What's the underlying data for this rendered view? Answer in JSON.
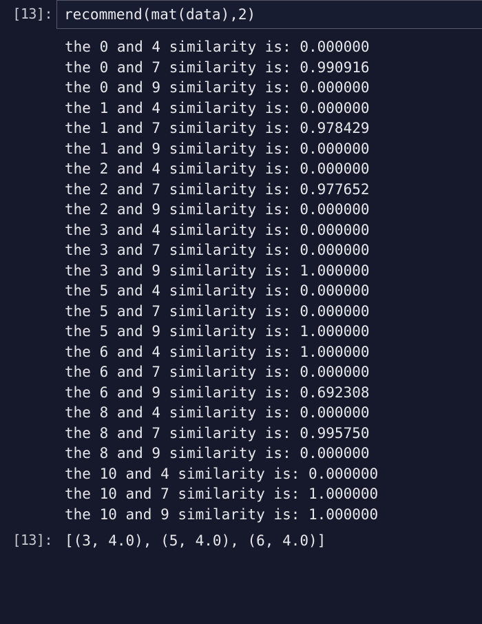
{
  "input_prompt": "[13]:",
  "input_code": "recommend(mat(data),2)",
  "output_prompt": "[13]:",
  "output_lines": [
    "the 0 and 4 similarity is: 0.000000",
    "the 0 and 7 similarity is: 0.990916",
    "the 0 and 9 similarity is: 0.000000",
    "the 1 and 4 similarity is: 0.000000",
    "the 1 and 7 similarity is: 0.978429",
    "the 1 and 9 similarity is: 0.000000",
    "the 2 and 4 similarity is: 0.000000",
    "the 2 and 7 similarity is: 0.977652",
    "the 2 and 9 similarity is: 0.000000",
    "the 3 and 4 similarity is: 0.000000",
    "the 3 and 7 similarity is: 0.000000",
    "the 3 and 9 similarity is: 1.000000",
    "the 5 and 4 similarity is: 0.000000",
    "the 5 and 7 similarity is: 0.000000",
    "the 5 and 9 similarity is: 1.000000",
    "the 6 and 4 similarity is: 1.000000",
    "the 6 and 7 similarity is: 0.000000",
    "the 6 and 9 similarity is: 0.692308",
    "the 8 and 4 similarity is: 0.000000",
    "the 8 and 7 similarity is: 0.995750",
    "the 8 and 9 similarity is: 0.000000",
    "the 10 and 4 similarity is: 0.000000",
    "the 10 and 7 similarity is: 1.000000",
    "the 10 and 9 similarity is: 1.000000"
  ],
  "result_text": "[(3, 4.0), (5, 4.0), (6, 4.0)]"
}
